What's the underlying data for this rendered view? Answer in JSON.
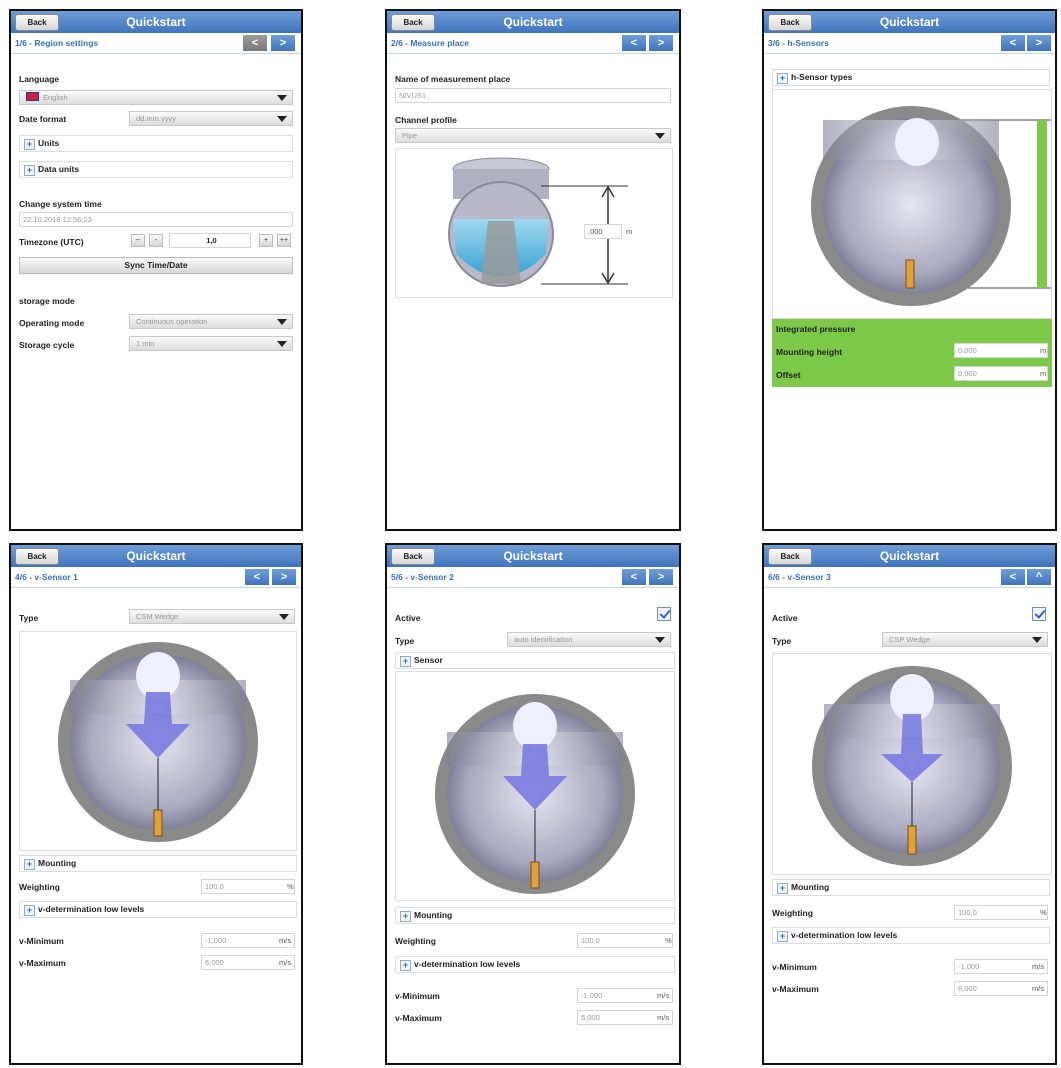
{
  "common": {
    "back": "Back",
    "title": "Quickstart",
    "prev": "<",
    "next": ">",
    "up": "^"
  },
  "p1": {
    "step": "1/6 - Region settings",
    "language_label": "Language",
    "language_value": "English",
    "date_format_label": "Date format",
    "date_format_value": "dd.mm.yyyy",
    "units": "Units",
    "data_units": "Data units",
    "change_time_label": "Change system time",
    "time_value": "22.10.2018 12:56:23",
    "timezone_label": "Timezone (UTC)",
    "tz_dec2": "--",
    "tz_dec1": "-",
    "tz_value": "1,0",
    "tz_inc1": "+",
    "tz_inc2": "++",
    "sync_button": "Sync Time/Date",
    "storage_mode": "storage mode",
    "operating_mode_label": "Operating mode",
    "operating_mode_value": "Continuous operation",
    "storage_cycle_label": "Storage cycle",
    "storage_cycle_value": "1 min"
  },
  "p2": {
    "step": "2/6 - Measure place",
    "name_label": "Name of measurement place",
    "name_value": "NIVUS1",
    "profile_label": "Channel profile",
    "profile_value": "Pipe",
    "dim_value": ",000",
    "dim_unit": "m"
  },
  "p3": {
    "step": "3/6 - h-Sensors",
    "types": "h-Sensor types",
    "integrated": "Integrated pressure",
    "mounting_label": "Mounting height",
    "mounting_value": "0,000",
    "offset_label": "Offset",
    "offset_value": "0,000",
    "unit": "m"
  },
  "p4": {
    "step": "4/6 - v-Sensor 1",
    "type_label": "Type",
    "type_value": "CSM Wedge",
    "mounting": "Mounting",
    "weighting_label": "Weighting",
    "weighting_value": "100,0",
    "weighting_unit": "%",
    "low_levels": "v-determination low levels",
    "vmin_label": "v-Minimum",
    "vmin_value": "-1,000",
    "vmax_label": "v-Maximum",
    "vmax_value": "6,000",
    "v_unit": "m/s"
  },
  "p5": {
    "step": "5/6 - v-Sensor 2",
    "active_label": "Active",
    "type_label": "Type",
    "type_value": "auto identification",
    "sensor": "Sensor",
    "mounting": "Mounting",
    "weighting_label": "Weighting",
    "weighting_value": "100,0",
    "weighting_unit": "%",
    "low_levels": "v-determination low levels",
    "vmin_label": "v-Minimum",
    "vmin_value": "-1,000",
    "vmax_label": "v-Maximum",
    "vmax_value": "6,000",
    "v_unit": "m/s"
  },
  "p6": {
    "step": "6/6 - v-Sensor 3",
    "active_label": "Active",
    "type_label": "Type",
    "type_value": "CSP Wedge",
    "mounting": "Mounting",
    "weighting_label": "Weighting",
    "weighting_value": "100,0",
    "weighting_unit": "%",
    "low_levels": "v-determination low levels",
    "vmin_label": "v-Minimum",
    "vmin_value": "-1,000",
    "vmax_label": "v-Maximum",
    "vmax_value": "6,000",
    "v_unit": "m/s"
  }
}
